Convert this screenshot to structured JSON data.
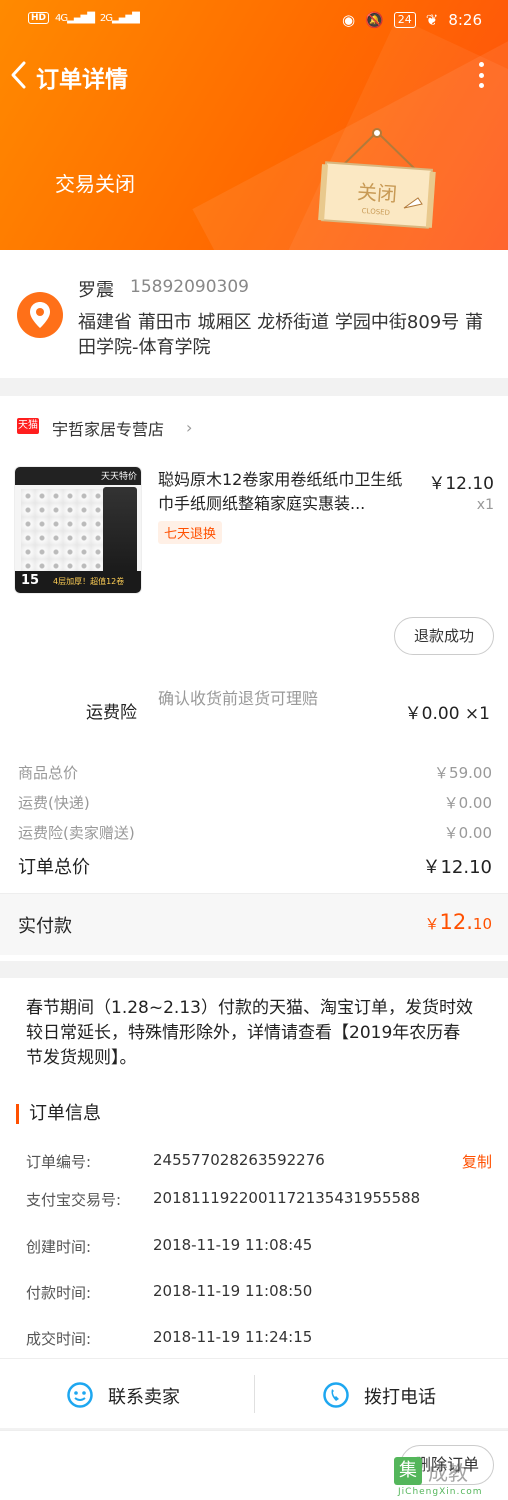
{
  "status_bar": {
    "hd": "HD",
    "net1": "4G",
    "net2": "2G",
    "battery": "24",
    "time": "8:26"
  },
  "nav": {
    "title": "订单详情"
  },
  "order_status": {
    "text": "交易关闭",
    "sign_text": "关闭",
    "sign_sub": "CLOSED"
  },
  "address": {
    "name": "罗震",
    "phone": "15892090309",
    "line": "福建省 莆田市 城厢区 龙桥街道 学园中街809号 莆田学院-体育学院"
  },
  "shop": {
    "badge": "天猫",
    "name": "宇哲家居专营店"
  },
  "product": {
    "title": "聪妈原木12卷家用卷纸纸巾卫生纸巾手纸厕纸整箱家庭实惠装...",
    "price": "￥12.10",
    "qty": "x1",
    "tag": "七天退换",
    "refund_status": "退款成功",
    "thumb_brand": "天天特价",
    "thumb_count": "15",
    "thumb_slogan": "4层加厚！超值12卷"
  },
  "insurance": {
    "label": "运费险",
    "desc": "确认收货前退货可理赔",
    "value": "￥0.00 ×1"
  },
  "summary": [
    {
      "label": "商品总价",
      "value": "￥59.00"
    },
    {
      "label": "运费(快递)",
      "value": "￥0.00"
    },
    {
      "label": "运费险(卖家赠送)",
      "value": "￥0.00"
    }
  ],
  "total": {
    "label": "订单总价",
    "value": "￥12.10"
  },
  "paid": {
    "label": "实付款",
    "symbol": "￥",
    "integer": "12.",
    "decimal": "10"
  },
  "notice": "春节期间（1.28~2.13）付款的天猫、淘宝订单，发货时效较日常延长，特殊情形除外，详情请查看【2019年农历春节发货规则】。",
  "order_info": {
    "heading": "订单信息",
    "copy_label": "复制",
    "rows": [
      {
        "label": "订单编号:",
        "value": "245577028263592276"
      },
      {
        "label": "支付宝交易号:",
        "value": "2018111922001172135431955588"
      },
      {
        "label": "创建时间:",
        "value": "2018-11-19 11:08:45"
      },
      {
        "label": "付款时间:",
        "value": "2018-11-19 11:08:50"
      },
      {
        "label": "成交时间:",
        "value": "2018-11-19 11:24:15"
      }
    ]
  },
  "contact": {
    "seller": "联系卖家",
    "phone": "拨打电话"
  },
  "footer": {
    "delete": "删除订单",
    "watermark_box": "集",
    "watermark_cn": "成教",
    "watermark_en": "JiChengXin.com"
  },
  "colors": {
    "accent": "#ff5000",
    "hero": "#ff7a00"
  }
}
